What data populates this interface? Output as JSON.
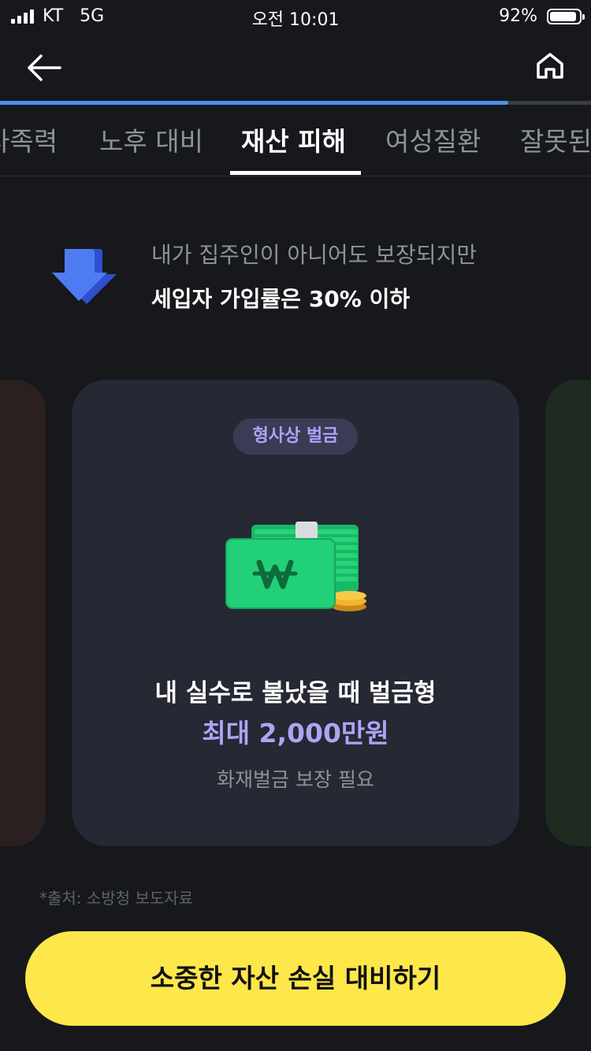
{
  "status_bar": {
    "carrier": "KT",
    "network": "5G",
    "time": "오전 10:01",
    "battery": "92%"
  },
  "nav": {
    "back_icon": "arrow-left-icon",
    "home_icon": "home-icon",
    "progress": 0.86,
    "accent": "#4a90f0"
  },
  "tabs": [
    {
      "label": "사족력"
    },
    {
      "label": "노후 대비"
    },
    {
      "label": "재산 피해"
    },
    {
      "label": "여성질환"
    },
    {
      "label": "잘못된"
    }
  ],
  "notice": {
    "icon": "down-arrow-icon",
    "line1": "내가 집주인이 아니어도 보장되지만",
    "line2": "세입자 가입률은 30% 이하"
  },
  "card": {
    "badge": "형사상 벌금",
    "illustration": "money-wallet-icon",
    "title": "내 실수로 불났을 때 벌금형",
    "amount": "최대 2,000만원",
    "note": "화재벌금 보장 필요",
    "accent": "#a9a6f5"
  },
  "source": "*출처: 소방청 보도자료",
  "cta": {
    "label": "소중한 자산 손실 대비하기",
    "color": "#fde74a"
  }
}
